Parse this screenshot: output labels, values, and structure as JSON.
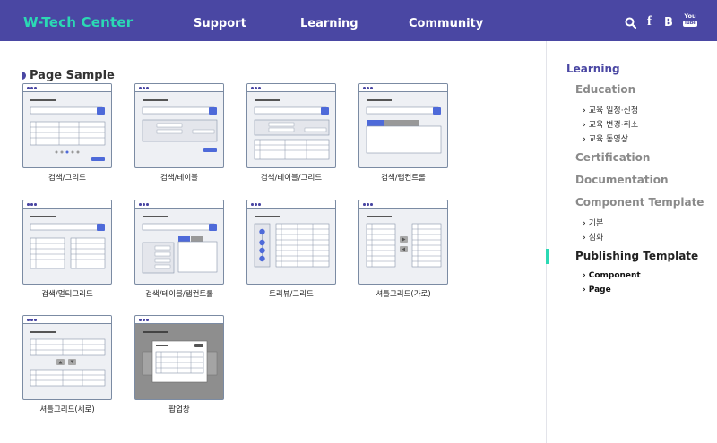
{
  "header": {
    "logo": "W-Tech Center",
    "nav": [
      {
        "label": "Support"
      },
      {
        "label": "Learning"
      },
      {
        "label": "Community"
      }
    ],
    "icons": [
      "search-icon",
      "facebook-icon",
      "blog-icon",
      "youtube-icon"
    ],
    "icon_glyphs": {
      "facebook": "f",
      "blog": "B",
      "youtube_top": "You",
      "youtube_bottom": "Tube"
    },
    "bg_color": "#4a47a3",
    "logo_color": "#2bd9b4"
  },
  "main": {
    "title": "Page Sample",
    "cards": [
      {
        "label": "검색/그리드",
        "kind": "grid"
      },
      {
        "label": "검색/테이블",
        "kind": "table"
      },
      {
        "label": "검색/테이블/그리드",
        "kind": "table-grid"
      },
      {
        "label": "검색/탭컨트롤",
        "kind": "tab"
      },
      {
        "label": "검색/멀티그리드",
        "kind": "multigrid"
      },
      {
        "label": "검색/테이블/탭컨트롤",
        "kind": "table-tab"
      },
      {
        "label": "트리뷰/그리드",
        "kind": "tree"
      },
      {
        "label": "셔틀그리드(가로)",
        "kind": "shuttle-h"
      },
      {
        "label": "셔틀그리드(세로)",
        "kind": "shuttle-v"
      },
      {
        "label": "팝업창",
        "kind": "popup"
      }
    ]
  },
  "sidebar": {
    "root": "Learning",
    "sections": [
      {
        "label": "Education",
        "items": [
          "교육 일정·신청",
          "교육 변경·취소",
          "교육 동영상"
        ]
      },
      {
        "label": "Certification",
        "items": []
      },
      {
        "label": "Documentation",
        "items": []
      },
      {
        "label": "Component Template",
        "items": [
          "기본",
          "심화"
        ]
      },
      {
        "label": "Publishing Template",
        "active": true,
        "items": [
          "Component",
          "Page"
        ]
      }
    ],
    "accent_color": "#2bd9b4"
  }
}
